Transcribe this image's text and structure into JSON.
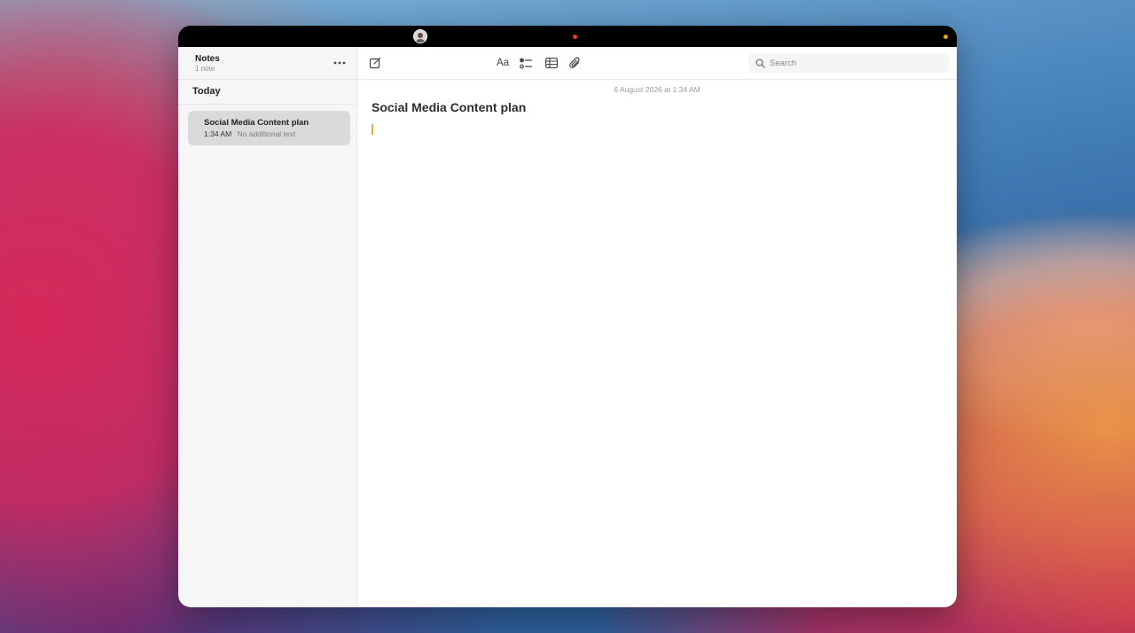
{
  "colors": {
    "accent_caret": "#e2b23c",
    "selected_note_bg": "#dadada",
    "status_dot_red": "#e0402a",
    "status_dot_orange": "#f0a020"
  },
  "statusbar": {
    "icons": [
      "user-avatar-icon",
      "recording-dot-icon",
      "indicator-dot-icon"
    ]
  },
  "sidebar": {
    "title": "Notes",
    "count": "1 note",
    "more_icon": "ellipsis-icon",
    "section": "Today",
    "notes": [
      {
        "title": "Social Media Content plan",
        "time": "1:34 AM",
        "preview": "No additional text",
        "selected": true
      }
    ]
  },
  "toolbar": {
    "icons": [
      "compose-icon",
      "format-text-icon",
      "checklist-icon",
      "table-icon",
      "attachment-icon",
      "share-icon",
      "ellipsis-icon"
    ],
    "format_label": "Aa",
    "search": {
      "placeholder": "Search",
      "value": ""
    }
  },
  "editor": {
    "date": "6 August 2026 at 1:34 AM",
    "title": "Social Media Content plan",
    "body": ""
  }
}
